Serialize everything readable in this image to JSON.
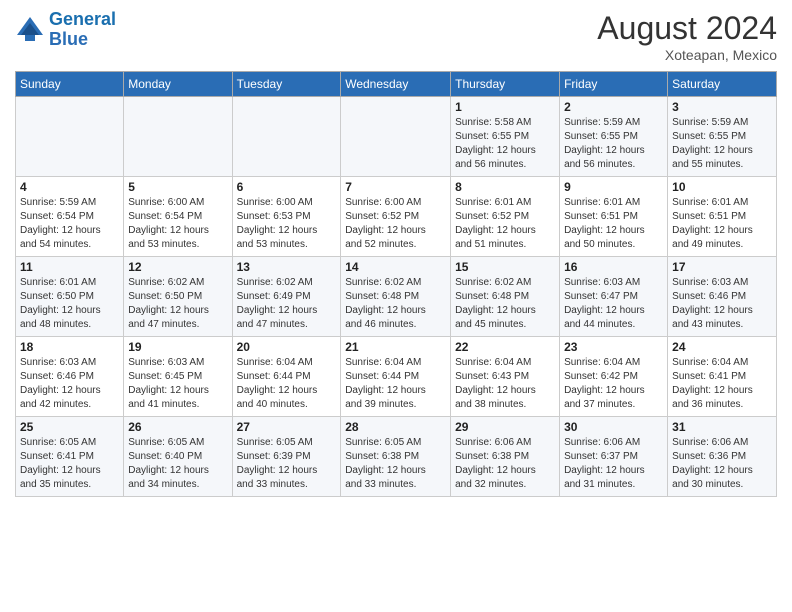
{
  "logo": {
    "line1": "General",
    "line2": "Blue"
  },
  "title": "August 2024",
  "location": "Xoteapan, Mexico",
  "days_of_week": [
    "Sunday",
    "Monday",
    "Tuesday",
    "Wednesday",
    "Thursday",
    "Friday",
    "Saturday"
  ],
  "weeks": [
    [
      {
        "day": "",
        "info": ""
      },
      {
        "day": "",
        "info": ""
      },
      {
        "day": "",
        "info": ""
      },
      {
        "day": "",
        "info": ""
      },
      {
        "day": "1",
        "info": "Sunrise: 5:58 AM\nSunset: 6:55 PM\nDaylight: 12 hours\nand 56 minutes."
      },
      {
        "day": "2",
        "info": "Sunrise: 5:59 AM\nSunset: 6:55 PM\nDaylight: 12 hours\nand 56 minutes."
      },
      {
        "day": "3",
        "info": "Sunrise: 5:59 AM\nSunset: 6:55 PM\nDaylight: 12 hours\nand 55 minutes."
      }
    ],
    [
      {
        "day": "4",
        "info": "Sunrise: 5:59 AM\nSunset: 6:54 PM\nDaylight: 12 hours\nand 54 minutes."
      },
      {
        "day": "5",
        "info": "Sunrise: 6:00 AM\nSunset: 6:54 PM\nDaylight: 12 hours\nand 53 minutes."
      },
      {
        "day": "6",
        "info": "Sunrise: 6:00 AM\nSunset: 6:53 PM\nDaylight: 12 hours\nand 53 minutes."
      },
      {
        "day": "7",
        "info": "Sunrise: 6:00 AM\nSunset: 6:52 PM\nDaylight: 12 hours\nand 52 minutes."
      },
      {
        "day": "8",
        "info": "Sunrise: 6:01 AM\nSunset: 6:52 PM\nDaylight: 12 hours\nand 51 minutes."
      },
      {
        "day": "9",
        "info": "Sunrise: 6:01 AM\nSunset: 6:51 PM\nDaylight: 12 hours\nand 50 minutes."
      },
      {
        "day": "10",
        "info": "Sunrise: 6:01 AM\nSunset: 6:51 PM\nDaylight: 12 hours\nand 49 minutes."
      }
    ],
    [
      {
        "day": "11",
        "info": "Sunrise: 6:01 AM\nSunset: 6:50 PM\nDaylight: 12 hours\nand 48 minutes."
      },
      {
        "day": "12",
        "info": "Sunrise: 6:02 AM\nSunset: 6:50 PM\nDaylight: 12 hours\nand 47 minutes."
      },
      {
        "day": "13",
        "info": "Sunrise: 6:02 AM\nSunset: 6:49 PM\nDaylight: 12 hours\nand 47 minutes."
      },
      {
        "day": "14",
        "info": "Sunrise: 6:02 AM\nSunset: 6:48 PM\nDaylight: 12 hours\nand 46 minutes."
      },
      {
        "day": "15",
        "info": "Sunrise: 6:02 AM\nSunset: 6:48 PM\nDaylight: 12 hours\nand 45 minutes."
      },
      {
        "day": "16",
        "info": "Sunrise: 6:03 AM\nSunset: 6:47 PM\nDaylight: 12 hours\nand 44 minutes."
      },
      {
        "day": "17",
        "info": "Sunrise: 6:03 AM\nSunset: 6:46 PM\nDaylight: 12 hours\nand 43 minutes."
      }
    ],
    [
      {
        "day": "18",
        "info": "Sunrise: 6:03 AM\nSunset: 6:46 PM\nDaylight: 12 hours\nand 42 minutes."
      },
      {
        "day": "19",
        "info": "Sunrise: 6:03 AM\nSunset: 6:45 PM\nDaylight: 12 hours\nand 41 minutes."
      },
      {
        "day": "20",
        "info": "Sunrise: 6:04 AM\nSunset: 6:44 PM\nDaylight: 12 hours\nand 40 minutes."
      },
      {
        "day": "21",
        "info": "Sunrise: 6:04 AM\nSunset: 6:44 PM\nDaylight: 12 hours\nand 39 minutes."
      },
      {
        "day": "22",
        "info": "Sunrise: 6:04 AM\nSunset: 6:43 PM\nDaylight: 12 hours\nand 38 minutes."
      },
      {
        "day": "23",
        "info": "Sunrise: 6:04 AM\nSunset: 6:42 PM\nDaylight: 12 hours\nand 37 minutes."
      },
      {
        "day": "24",
        "info": "Sunrise: 6:04 AM\nSunset: 6:41 PM\nDaylight: 12 hours\nand 36 minutes."
      }
    ],
    [
      {
        "day": "25",
        "info": "Sunrise: 6:05 AM\nSunset: 6:41 PM\nDaylight: 12 hours\nand 35 minutes."
      },
      {
        "day": "26",
        "info": "Sunrise: 6:05 AM\nSunset: 6:40 PM\nDaylight: 12 hours\nand 34 minutes."
      },
      {
        "day": "27",
        "info": "Sunrise: 6:05 AM\nSunset: 6:39 PM\nDaylight: 12 hours\nand 33 minutes."
      },
      {
        "day": "28",
        "info": "Sunrise: 6:05 AM\nSunset: 6:38 PM\nDaylight: 12 hours\nand 33 minutes."
      },
      {
        "day": "29",
        "info": "Sunrise: 6:06 AM\nSunset: 6:38 PM\nDaylight: 12 hours\nand 32 minutes."
      },
      {
        "day": "30",
        "info": "Sunrise: 6:06 AM\nSunset: 6:37 PM\nDaylight: 12 hours\nand 31 minutes."
      },
      {
        "day": "31",
        "info": "Sunrise: 6:06 AM\nSunset: 6:36 PM\nDaylight: 12 hours\nand 30 minutes."
      }
    ]
  ]
}
